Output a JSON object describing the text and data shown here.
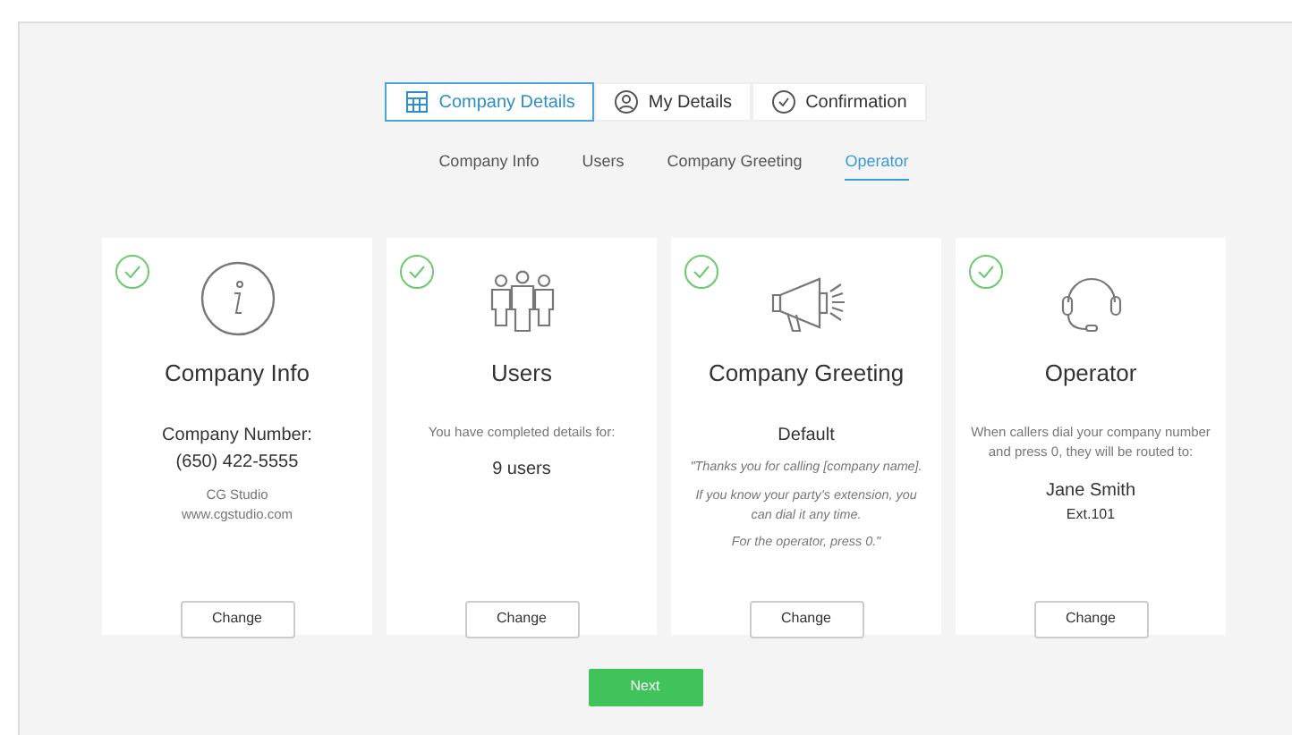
{
  "steps": [
    {
      "label": "Company Details",
      "kind": "grid",
      "selected": true
    },
    {
      "label": "My Details",
      "kind": "person",
      "selected": false
    },
    {
      "label": "Confirmation",
      "kind": "check",
      "selected": false
    }
  ],
  "subnav": [
    {
      "label": "Company Info",
      "selected": false
    },
    {
      "label": "Users",
      "selected": false
    },
    {
      "label": "Company Greeting",
      "selected": false
    },
    {
      "label": "Operator",
      "selected": true
    }
  ],
  "cards": [
    {
      "title": "Company Info",
      "kind": "info",
      "completed": true,
      "lines": [
        {
          "kind": "strong",
          "text": "Company Number:\n(650) 422-5555"
        },
        {
          "kind": "muted",
          "text": "CG Studio\nwww.cgstudio.com"
        }
      ],
      "button": "Change"
    },
    {
      "title": "Users",
      "kind": "users",
      "completed": true,
      "lines": [
        {
          "kind": "muted",
          "text": "You have completed details for:"
        },
        {
          "kind": "strong",
          "text": "9 users"
        }
      ],
      "button": "Change"
    },
    {
      "title": "Company Greeting",
      "kind": "megaphone",
      "completed": true,
      "lines": [
        {
          "kind": "strong",
          "text": "Default"
        },
        {
          "kind": "italic",
          "text": "\"Thanks you for calling [company name]."
        },
        {
          "kind": "italic",
          "text": "If you know your party's extension, you can dial it any time."
        },
        {
          "kind": "italic",
          "text": "For the operator, press 0.\""
        }
      ],
      "button": "Change"
    },
    {
      "title": "Operator",
      "kind": "headset",
      "completed": true,
      "lines": [
        {
          "kind": "muted",
          "text": "When callers dial your company number and press 0, they will be routed to:"
        },
        {
          "kind": "name",
          "text": "Jane Smith"
        },
        {
          "kind": "small",
          "text": "Ext.101"
        }
      ],
      "button": "Change"
    }
  ],
  "next_button": "Next"
}
